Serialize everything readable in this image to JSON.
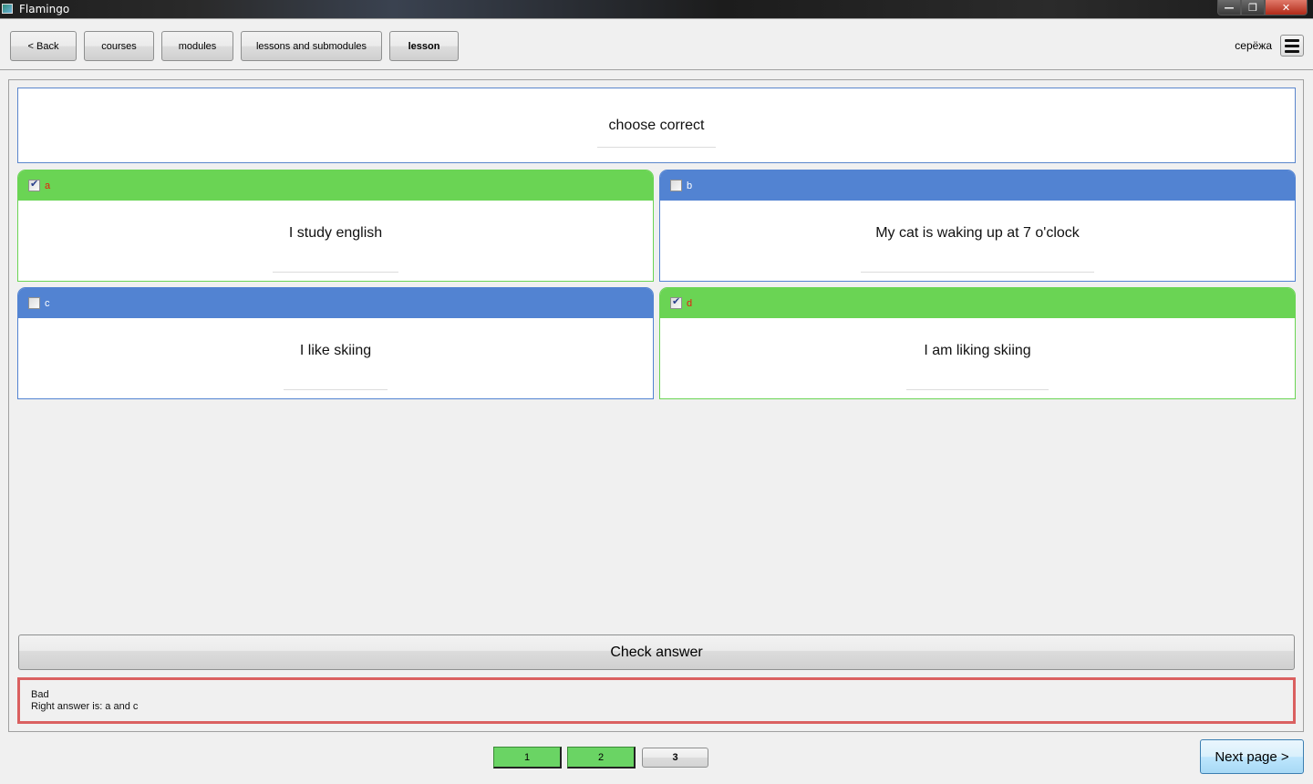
{
  "window": {
    "title": "Flamingo",
    "controls": {
      "minimize": "—",
      "maximize": "❐",
      "close": "✕"
    }
  },
  "nav": {
    "back_label": "< Back",
    "breadcrumbs": [
      {
        "label": "courses"
      },
      {
        "label": "modules"
      },
      {
        "label": "lessons and submodules"
      },
      {
        "label": "lesson",
        "current": true
      }
    ],
    "user_name": "серёжа",
    "menu_icon": "hamburger-menu-icon"
  },
  "question": {
    "text": "choose correct"
  },
  "options": [
    {
      "letter": "a",
      "text": "I study english",
      "checked": true,
      "color": "#6ad454"
    },
    {
      "letter": "b",
      "text": "My cat is waking up at 7 o'clock",
      "checked": false,
      "color": "#5283d2"
    },
    {
      "letter": "c",
      "text": "I like skiing",
      "checked": false,
      "color": "#5283d2"
    },
    {
      "letter": "d",
      "text": "I am liking skiing",
      "checked": true,
      "color": "#6ad454"
    }
  ],
  "check_button_label": "Check answer",
  "result": {
    "status": "Bad",
    "message": "Right answer is: a and c",
    "border_color": "#da6060"
  },
  "pagination": {
    "pages": [
      {
        "label": "1",
        "state": "done"
      },
      {
        "label": "2",
        "state": "done"
      },
      {
        "label": "3",
        "state": "current"
      }
    ],
    "next_label": "Next page >"
  }
}
